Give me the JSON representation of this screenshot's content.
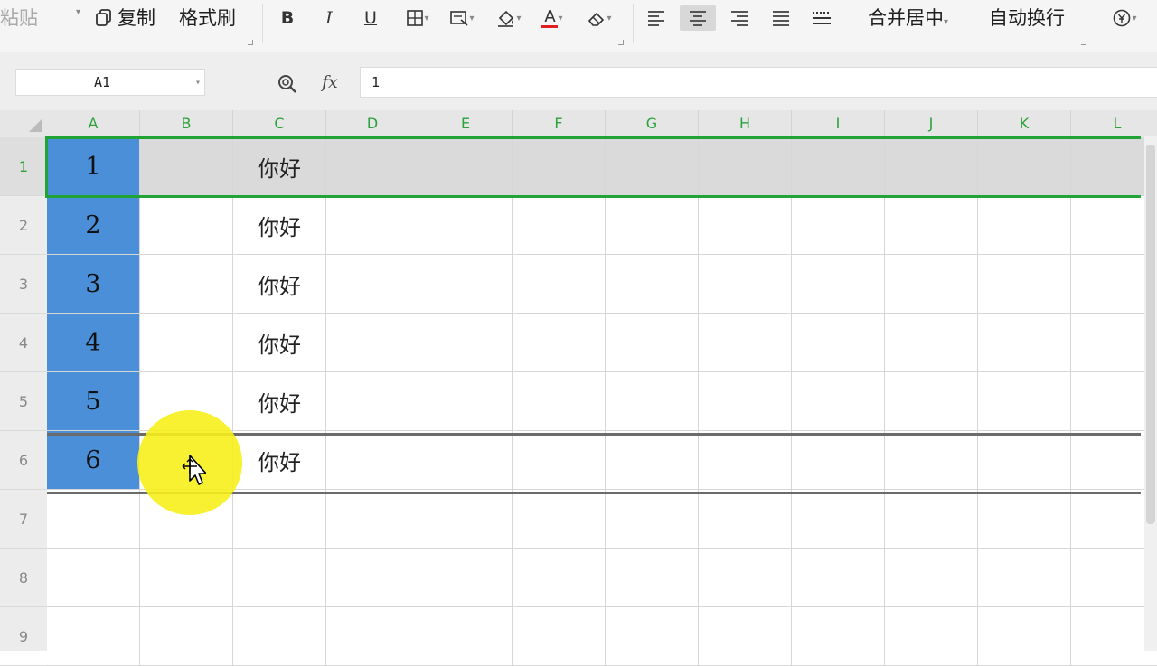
{
  "ribbon": {
    "paste_label": "粘贴",
    "copy_label": "复制",
    "format_painter_label": "格式刷",
    "bold_label": "B",
    "italic_label": "I",
    "underline_label": "U",
    "font_color_label": "A",
    "merge_center_label": "合并居中",
    "wrap_text_label": "自动换行",
    "dropdown_marker": "▾"
  },
  "formula_bar": {
    "name_box": "A1",
    "fx_label": "fx",
    "formula_value": "1"
  },
  "sheet": {
    "columns": [
      "A",
      "B",
      "C",
      "D",
      "E",
      "F",
      "G",
      "H",
      "I",
      "J",
      "K",
      "L"
    ],
    "row_numbers": [
      "1",
      "2",
      "3",
      "4",
      "5",
      "6",
      "7",
      "8",
      "9"
    ],
    "column_a": [
      "1",
      "2",
      "3",
      "4",
      "5",
      "6"
    ],
    "column_c": [
      "你好",
      "你好",
      "你好",
      "你好",
      "你好",
      "你好"
    ],
    "selected_row": "1",
    "colors": {
      "selection_green": "#21a335",
      "column_a_fill": "#4a8fd8",
      "highlight_yellow": "#f6ef1c"
    }
  }
}
